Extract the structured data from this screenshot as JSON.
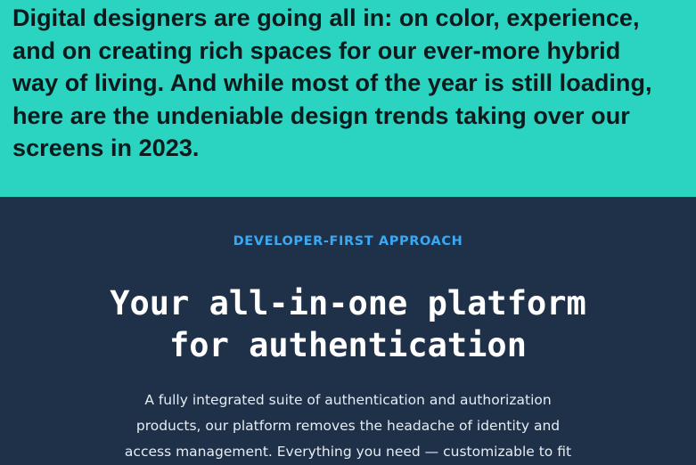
{
  "intro": {
    "lines": [
      "Digital designers are going all in: on color, experience,",
      "and on creating rich spaces for our ever-more hybrid",
      "way of living. And while most of the year is still loading,",
      "here are the undeniable design trends taking over our",
      "screens in 2023."
    ]
  },
  "section": {
    "eyebrow": "DEVELOPER-FIRST APPROACH",
    "headline_lines": [
      "Your all-in-one platform",
      "for authentication"
    ],
    "body_lines": [
      "A fully integrated suite of authentication and authorization",
      "products, our platform removes the headache of identity and",
      "access management. Everything you need — customizable to fit"
    ]
  },
  "colors": {
    "teal_background": "#2bd4c0",
    "navy_background": "#1f3149",
    "eyebrow_accent": "#3aa9f5"
  }
}
